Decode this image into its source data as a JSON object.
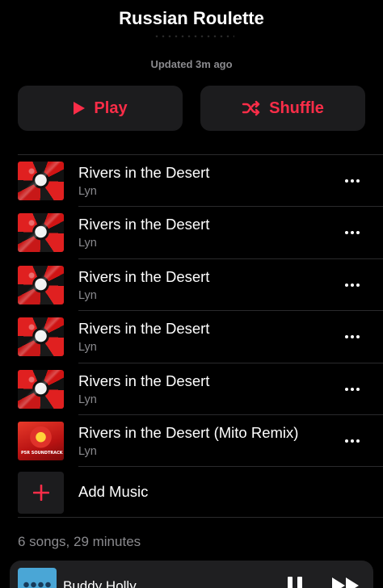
{
  "playlist": {
    "title": "Russian Roulette",
    "updated": "Updated 3m ago"
  },
  "actions": {
    "play_label": "Play",
    "shuffle_label": "Shuffle",
    "accent_color": "#fa2d48"
  },
  "tracks": [
    {
      "title": "Rivers in the Desert",
      "artist": "Lyn",
      "art": "persona-5-original-soundtrack-cover"
    },
    {
      "title": "Rivers in the Desert",
      "artist": "Lyn",
      "art": "persona-5-original-soundtrack-cover"
    },
    {
      "title": "Rivers in the Desert",
      "artist": "Lyn",
      "art": "persona-5-original-soundtrack-cover"
    },
    {
      "title": "Rivers in the Desert",
      "artist": "Lyn",
      "art": "persona-5-original-soundtrack-cover"
    },
    {
      "title": "Rivers in the Desert",
      "artist": "Lyn",
      "art": "persona-5-original-soundtrack-cover"
    },
    {
      "title": "Rivers in the Desert (Mito Remix)",
      "artist": "Lyn",
      "art": "persona-5-royal-soundtrack-cover"
    }
  ],
  "add_music": {
    "label": "Add Music"
  },
  "summary": "6 songs, 29 minutes",
  "now_playing": {
    "title": "Buddy Holly"
  }
}
